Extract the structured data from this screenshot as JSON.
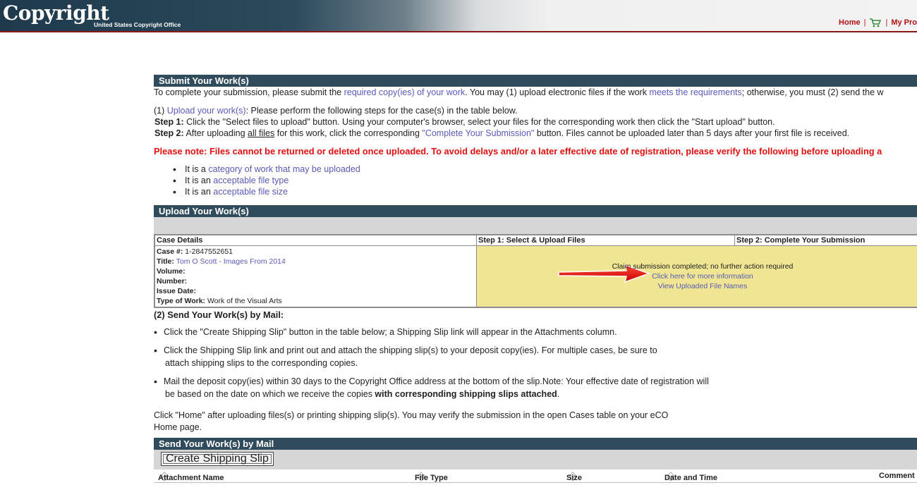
{
  "header": {
    "logo_text": "Copyright",
    "logo_sub": "United States Copyright Office",
    "nav": {
      "home": "Home",
      "sep": "|",
      "my_profile": "My Pro"
    }
  },
  "submit": {
    "bar": "Submit Your Work(s)",
    "intro_1": "To complete your submission, please submit the ",
    "intro_link1": "required copy(ies) of your work",
    "intro_2": ". You may (1) upload electronic files if the work ",
    "intro_link2": "meets the requirements",
    "intro_3": "; otherwise, you must (2) send the w",
    "opt1_prefix": "(1) ",
    "opt1_link": "Upload your work(s)",
    "opt1_rest": ": Please perform the following steps for the case(s) in the table below.",
    "step1_label": "Step 1:",
    "step1_text": " Click the \"Select files to upload\" button. Using your computer's browser, select your files for the corresponding work then click the \"Start upload\" button.",
    "step2_label": "Step 2:",
    "step2_a": " After uploading ",
    "step2_u": "all files",
    "step2_b": " for this work, click the corresponding ",
    "step2_link": "\"Complete Your Submission\"",
    "step2_c": " button. Files cannot be uploaded later than 5 days after your first file is received.",
    "note": "Please note: Files cannot be returned or deleted once uploaded. To avoid delays and/or a later effective date of registration, please verify the following before uploading a",
    "bullets": [
      {
        "pre": "It is a ",
        "link": "category of work that may be uploaded"
      },
      {
        "pre": "It is an ",
        "link": "acceptable file type"
      },
      {
        "pre": "It is an ",
        "link": "acceptable file size"
      }
    ]
  },
  "upload": {
    "bar": "Upload Your Work(s)",
    "col_case": "Case Details",
    "col_step1": "Step 1: Select & Upload Files",
    "col_step2": "Step 2: Complete Your Submission",
    "case_no_label": "Case #:",
    "case_no": "1-2847552651",
    "title_label": "Title:",
    "title": "Tom O Scott - Images From 2014",
    "volume_label": "Volume:",
    "number_label": "Number:",
    "issue_label": "Issue Date:",
    "type_label": "Type of Work:",
    "type": "Work of the Visual Arts",
    "status": "Claim submission completed; no further action required",
    "more_info": "Click here for more information",
    "view_files": "View Uploaded File Names"
  },
  "mail": {
    "heading": "(2) Send Your Work(s) by Mail:",
    "b1": "Click the \"Create Shipping Slip\" button in the table below; a Shipping Slip link will appear in the Attachments column.",
    "b2a": "Click the Shipping Slip link and print out and attach the shipping slip(s) to your deposit copy(ies). For multiple cases, be sure to",
    "b2b": "attach shipping slips to the corresponding copies.",
    "b3a": "Mail the deposit copy(ies) within 30 days to the Copyright Office address at the bottom of the slip.Note: Your effective date of registration will",
    "b3b": "be based on the date on which we receive the copies ",
    "b3bold": "with corresponding shipping slips attached",
    "b3end": ".",
    "home_a": "Click \"Home\" after uploading files(s) or printing shipping slip(s). You may verify the submission in the open Cases table on your eCO",
    "home_b": "Home page.",
    "bar": "Send Your Work(s) by Mail",
    "ship_button": "Create Shipping Slip",
    "cols": {
      "name": "Attachment Name",
      "type": "File Type",
      "size": "Size",
      "date": "Date and Time",
      "comment": "Comment"
    }
  },
  "colors": {
    "header_dark": "#2f4b5c",
    "note_red": "#e01010",
    "status_yellow": "#efe592",
    "link": "#5a5ab8"
  }
}
